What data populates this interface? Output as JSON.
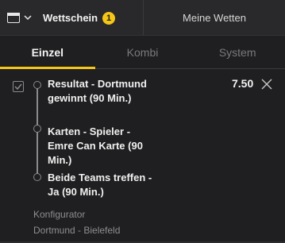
{
  "header": {
    "title": "Wettschein",
    "badge_count": "1",
    "my_bets_label": "Meine Wetten"
  },
  "tabs": [
    {
      "label": "Einzel",
      "active": true
    },
    {
      "label": "Kombi",
      "active": false
    },
    {
      "label": "System",
      "active": false
    }
  ],
  "bet": {
    "selections": [
      "Resultat - Dortmund gewinnt (90 Min.)",
      "Karten - Spieler - Emre Can Karte (90 Min.)",
      "Beide Teams treffen - Ja (90 Min.)"
    ],
    "odds": "7.50",
    "market_type": "Konfigurator",
    "event": "Dortmund - Bielefeld"
  },
  "colors": {
    "accent": "#f5c518",
    "background": "#1f1f21",
    "header_bg": "#29292b"
  },
  "icons": [
    "wallet-icon",
    "chevron-down-icon",
    "checkbox-icon",
    "close-icon"
  ]
}
